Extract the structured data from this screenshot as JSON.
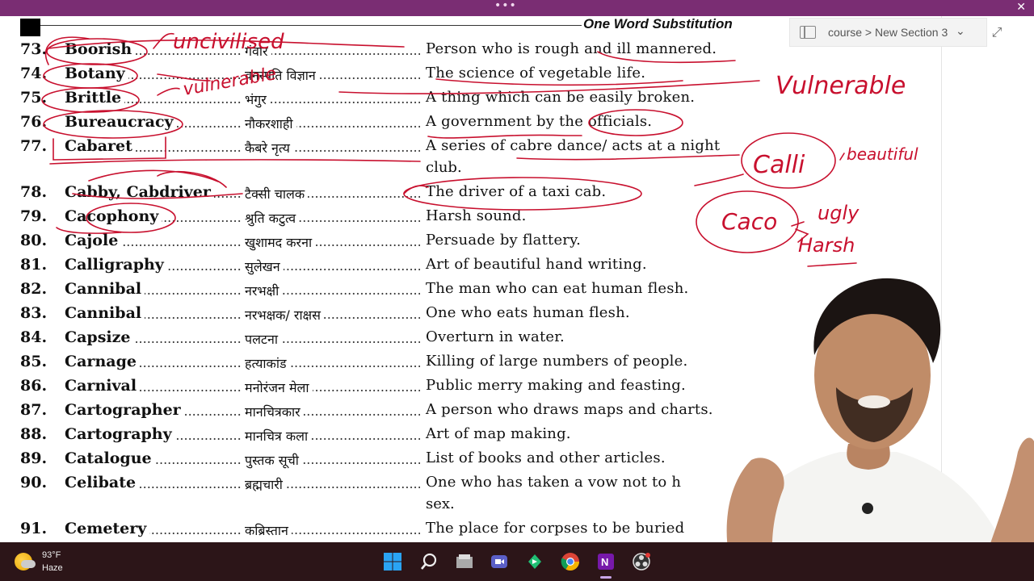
{
  "window": {
    "menu_dots": "•••",
    "close_glyph": "✕"
  },
  "header": {
    "title": "One Word Substitution"
  },
  "breadcrumb": {
    "text": "course > New Section 3"
  },
  "entries": [
    {
      "num": "73.",
      "word": "Boorish",
      "hindi": "गंवार",
      "meaning": "Person who is rough and ill mannered."
    },
    {
      "num": "74.",
      "word": "Botany",
      "hindi": "वनस्पति विज्ञान",
      "meaning": "The science of vegetable life."
    },
    {
      "num": "75.",
      "word": "Brittle",
      "hindi": "भंगुर",
      "meaning": "A thing which can be easily broken."
    },
    {
      "num": "76.",
      "word": "Bureaucracy",
      "hindi": "नौकरशाही",
      "meaning": "A government by the officials."
    },
    {
      "num": "77.",
      "word": "Cabaret",
      "hindi": "कैबरे नृत्य",
      "meaning": "A series of cabre dance/ acts at a night",
      "meaning2": "club."
    },
    {
      "num": "78.",
      "word": "Cabby, Cabdriver",
      "hindi": "टैक्सी चालक",
      "meaning": "The driver of a taxi cab."
    },
    {
      "num": "79.",
      "word": "Cacophony",
      "hindi": "श्रुति कटुत्व",
      "meaning": "Harsh sound."
    },
    {
      "num": "80.",
      "word": "Cajole",
      "hindi": "खुशामद करना",
      "meaning": "Persuade by flattery."
    },
    {
      "num": "81.",
      "word": "Calligraphy",
      "hindi": "सुलेखन",
      "meaning": "Art of beautiful hand writing."
    },
    {
      "num": "82.",
      "word": "Cannibal",
      "hindi": "नरभक्षी",
      "meaning": "The man who can eat human flesh."
    },
    {
      "num": "83.",
      "word": "Cannibal",
      "hindi": "नरभक्षक/ राक्षस",
      "meaning": "One who eats human flesh."
    },
    {
      "num": "84.",
      "word": "Capsize",
      "hindi": "पलटना",
      "meaning": "Overturn in water."
    },
    {
      "num": "85.",
      "word": "Carnage",
      "hindi": "हत्याकांड",
      "meaning": "Killing of large numbers of people."
    },
    {
      "num": "86.",
      "word": "Carnival",
      "hindi": "मनोरंजन मेला",
      "meaning": "Public merry making and feasting."
    },
    {
      "num": "87.",
      "word": "Cartographer",
      "hindi": "मानचित्रकार",
      "meaning": "A person who draws maps and charts."
    },
    {
      "num": "88.",
      "word": "Cartography",
      "hindi": "मानचित्र कला",
      "meaning": "Art of map making."
    },
    {
      "num": "89.",
      "word": "Catalogue",
      "hindi": "पुस्तक सूची",
      "meaning": "List of books and other articles."
    },
    {
      "num": "90.",
      "word": "Celibate",
      "hindi": "ब्रह्मचारी",
      "meaning": "One who has taken a vow not to h",
      "meaning2": "sex."
    },
    {
      "num": "91.",
      "word": "Cemetery",
      "hindi": "कब्रिस्तान",
      "meaning": "The place for corpses to be buried"
    }
  ],
  "annotations": {
    "uncivilised": "uncivilised",
    "vulnerable_small": "vulnerable",
    "vulnerable_big": "Vulnerable",
    "calli": "Calli",
    "beautiful": "beautiful",
    "caco": "Caco",
    "ugly": "ugly",
    "harsh": "Harsh"
  },
  "taskbar": {
    "temperature": "93°F",
    "condition": "Haze",
    "icons": [
      "windows-start-icon",
      "search-icon",
      "file-explorer-icon",
      "teams-icon",
      "media-app-icon",
      "chrome-icon",
      "onenote-icon",
      "obs-icon"
    ]
  },
  "colors": {
    "annotation": "#c8102e",
    "titlebar": "#7a2d73",
    "taskbar": "#2c1518"
  }
}
